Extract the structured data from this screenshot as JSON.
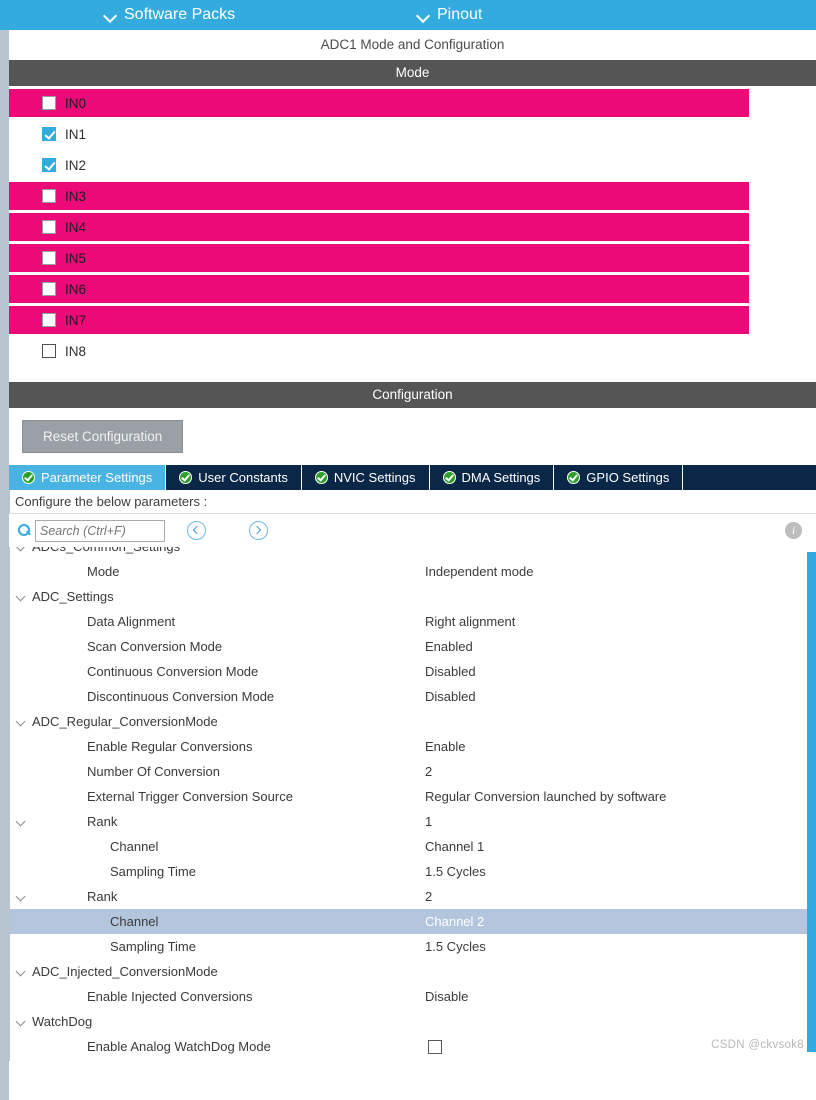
{
  "menubar": {
    "items": [
      {
        "label": "Software Packs",
        "icon": "chevron-down-icon"
      },
      {
        "label": "Pinout",
        "icon": "chevron-down-icon"
      }
    ]
  },
  "panel": {
    "title": "ADC1 Mode and Configuration",
    "mode_header": "Mode",
    "configuration_header": "Configuration"
  },
  "mode_list": {
    "rows": [
      {
        "label": "IN0",
        "checked": false,
        "highlighted": true
      },
      {
        "label": "IN1",
        "checked": true,
        "highlighted": false
      },
      {
        "label": "IN2",
        "checked": true,
        "highlighted": false
      },
      {
        "label": "IN3",
        "checked": false,
        "highlighted": true
      },
      {
        "label": "IN4",
        "checked": false,
        "highlighted": true
      },
      {
        "label": "IN5",
        "checked": false,
        "highlighted": true
      },
      {
        "label": "IN6",
        "checked": false,
        "highlighted": true
      },
      {
        "label": "IN7",
        "checked": false,
        "highlighted": true
      },
      {
        "label": "IN8",
        "checked": false,
        "highlighted": false
      }
    ]
  },
  "config": {
    "reset_button": "Reset Configuration",
    "tabs": [
      {
        "label": "Parameter Settings",
        "active": true,
        "icon": "green-check-icon"
      },
      {
        "label": "User Constants",
        "active": false,
        "icon": "green-check-icon"
      },
      {
        "label": "NVIC Settings",
        "active": false,
        "icon": "green-check-icon"
      },
      {
        "label": "DMA Settings",
        "active": false,
        "icon": "green-check-icon"
      },
      {
        "label": "GPIO Settings",
        "active": false,
        "icon": "green-check-icon"
      }
    ],
    "configure_note": "Configure the below parameters :",
    "search": {
      "placeholder": "Search (Ctrl+F)",
      "value": "",
      "icon": "search-icon",
      "prev_icon": "nav-prev-icon",
      "next_icon": "nav-next-icon",
      "info_icon": "info-icon",
      "info_glyph": "i"
    }
  },
  "tree": {
    "rows": [
      {
        "name": "ADCs_Common_Settings",
        "value": "",
        "indent": 0,
        "expandable": true,
        "selected": false
      },
      {
        "name": "Mode",
        "value": "Independent mode",
        "indent": 1,
        "expandable": false,
        "selected": false
      },
      {
        "name": "ADC_Settings",
        "value": "",
        "indent": 0,
        "expandable": true,
        "selected": false
      },
      {
        "name": "Data Alignment",
        "value": "Right alignment",
        "indent": 1,
        "expandable": false,
        "selected": false
      },
      {
        "name": "Scan Conversion Mode",
        "value": "Enabled",
        "indent": 1,
        "expandable": false,
        "selected": false
      },
      {
        "name": "Continuous Conversion Mode",
        "value": "Disabled",
        "indent": 1,
        "expandable": false,
        "selected": false
      },
      {
        "name": "Discontinuous Conversion Mode",
        "value": "Disabled",
        "indent": 1,
        "expandable": false,
        "selected": false
      },
      {
        "name": "ADC_Regular_ConversionMode",
        "value": "",
        "indent": 0,
        "expandable": true,
        "selected": false
      },
      {
        "name": "Enable Regular Conversions",
        "value": "Enable",
        "indent": 1,
        "expandable": false,
        "selected": false
      },
      {
        "name": "Number Of Conversion",
        "value": "2",
        "indent": 1,
        "expandable": false,
        "selected": false
      },
      {
        "name": "External Trigger Conversion Source",
        "value": "Regular Conversion launched by software",
        "indent": 1,
        "expandable": false,
        "selected": false
      },
      {
        "name": "Rank",
        "value": "1",
        "indent": 1,
        "expandable": true,
        "selected": false
      },
      {
        "name": "Channel",
        "value": "Channel 1",
        "indent": 2,
        "expandable": false,
        "selected": false
      },
      {
        "name": "Sampling Time",
        "value": "1.5 Cycles",
        "indent": 2,
        "expandable": false,
        "selected": false
      },
      {
        "name": "Rank",
        "value": "2",
        "indent": 1,
        "expandable": true,
        "selected": false
      },
      {
        "name": "Channel",
        "value": "Channel 2",
        "indent": 2,
        "expandable": false,
        "selected": true
      },
      {
        "name": "Sampling Time",
        "value": "1.5 Cycles",
        "indent": 2,
        "expandable": false,
        "selected": false
      },
      {
        "name": "ADC_Injected_ConversionMode",
        "value": "",
        "indent": 0,
        "expandable": true,
        "selected": false
      },
      {
        "name": "Enable Injected Conversions",
        "value": "Disable",
        "indent": 1,
        "expandable": false,
        "selected": false
      },
      {
        "name": "WatchDog",
        "value": "",
        "indent": 0,
        "expandable": true,
        "selected": false
      },
      {
        "name": "Enable Analog WatchDog Mode",
        "value": "",
        "indent": 1,
        "expandable": false,
        "selected": false,
        "checkbox": true
      }
    ]
  },
  "watermark": "CSDN @ckvsok8",
  "colors": {
    "accent_blue": "#34abdf",
    "tab_bar_dark": "#0b2747",
    "highlight_pink": "#eb0a78",
    "header_gray": "#555555",
    "selected_row": "#b3c6de",
    "check_green": "#2aa02a"
  }
}
